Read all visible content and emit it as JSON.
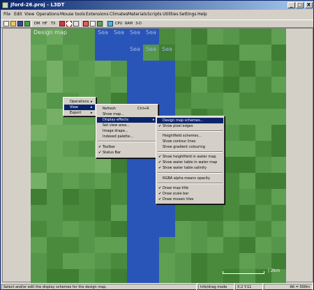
{
  "window": {
    "title": "jford-26.proj - L3DT",
    "min_glyph": "_",
    "max_glyph": "□",
    "close_glyph": "X"
  },
  "menubar": [
    "File",
    "Edit",
    "View",
    "Operations",
    "Mouse tools",
    "Extensions",
    "Climates",
    "Materials",
    "Scripts",
    "Utilities",
    "Settings",
    "Help"
  ],
  "toolbar": {
    "text_buttons": [
      "DM",
      "HF",
      "TX",
      "CPU",
      "RAM",
      "3-D"
    ]
  },
  "map": {
    "title": "Design map",
    "sea_label": "Sea",
    "scale_label": "| 2km"
  },
  "context_menu": {
    "items": [
      {
        "label": "Operations",
        "arrow": "▸"
      },
      {
        "label": "View",
        "arrow": "▸",
        "highlighted": true
      },
      {
        "label": "Export",
        "arrow": "▸"
      }
    ]
  },
  "view_menu": {
    "items": [
      {
        "label": "Refresh",
        "shortcut": "Ctrl+R"
      },
      {
        "label": "Show map..."
      },
      {
        "label": "Display effects",
        "arrow": "▸",
        "highlighted": true
      },
      {
        "label": "Set view area..."
      },
      {
        "label": "Image drape..."
      },
      {
        "label": "Indexed palette..."
      },
      {
        "label": "Toolbar",
        "checked": true
      },
      {
        "label": "Status Bar",
        "checked": true
      }
    ]
  },
  "effects_menu": {
    "items": [
      {
        "label": "Design map schemes...",
        "highlighted": true
      },
      {
        "label": "Show pixel edges",
        "checked": true
      },
      {
        "label": "Heightfield schemes..."
      },
      {
        "label": "Show contour lines"
      },
      {
        "label": "Show gradient colouring"
      },
      {
        "label": "Show heightfield in water map",
        "checked": true
      },
      {
        "label": "Show water table in water map",
        "checked": true
      },
      {
        "label": "Show water table salinity",
        "checked": true
      },
      {
        "label": "RGBA alpha means opacity"
      },
      {
        "label": "Draw map title",
        "checked": true
      },
      {
        "label": "Draw scale bar",
        "checked": true
      },
      {
        "label": "Draw mosaic tiles",
        "checked": true
      }
    ],
    "check_glyph": "✔"
  },
  "statusbar": {
    "message": "Select and/or edit the display schemes for the design map.",
    "mode": "Info/drag mode",
    "coords": "X:2 Y:11",
    "alt": "Alt = 500m"
  },
  "colors": {
    "sea": "#2a55b8",
    "titlebar": "#0a246a",
    "highlight": "#0a246a"
  }
}
